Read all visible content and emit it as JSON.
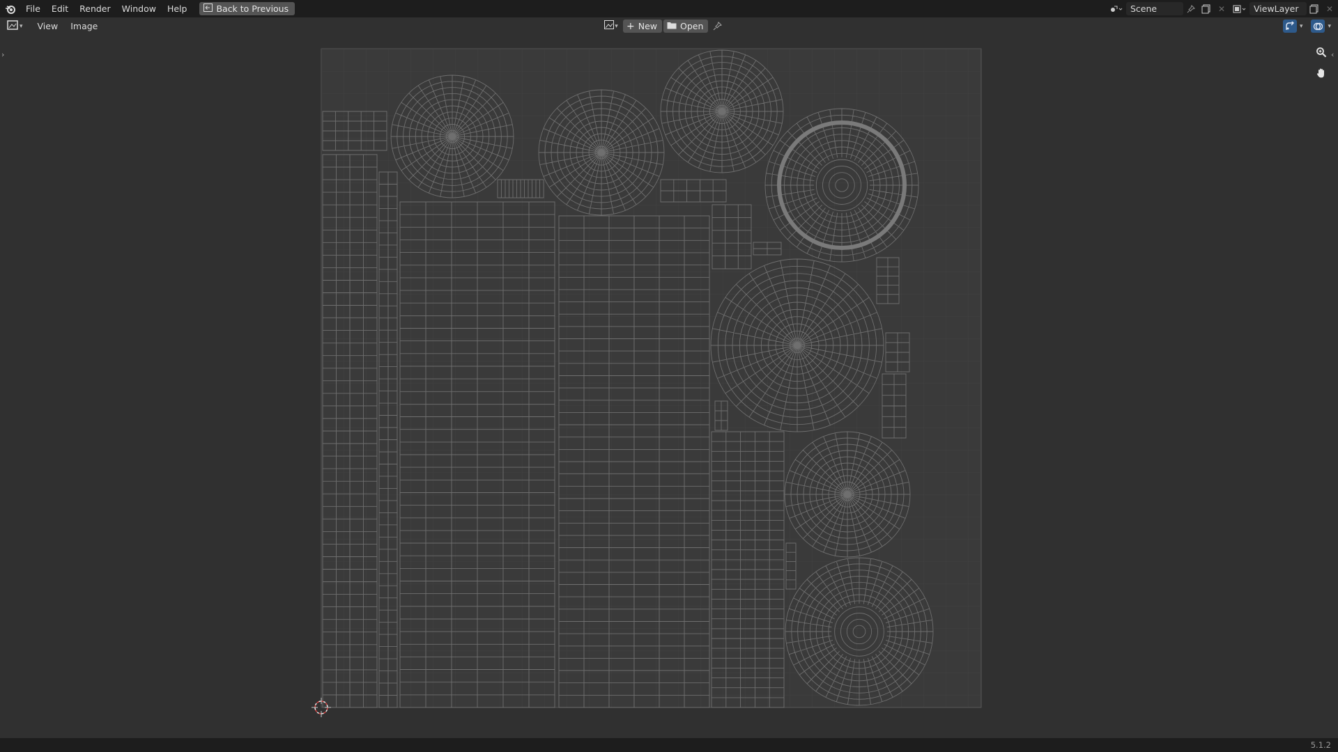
{
  "topbar": {
    "menus": [
      "File",
      "Edit",
      "Render",
      "Window",
      "Help"
    ],
    "back_button": "Back to Previous",
    "scene_name": "Scene",
    "view_layer_name": "ViewLayer"
  },
  "header": {
    "menus": [
      "View",
      "Image"
    ],
    "new_label": "New",
    "open_label": "Open"
  },
  "statusbar": {
    "version": "5.1.2"
  },
  "colors": {
    "background": "#303030",
    "topbar": "#1d1d1d",
    "button": "#545454",
    "accent_blue": "#2e5a8b",
    "uv_line": "#6e6e6e",
    "canvas": "#3c3c3c"
  },
  "icons": [
    "blender-logo-icon",
    "back-icon",
    "scene-icon",
    "view-layer-icon",
    "image-editor-icon",
    "image-browse-icon",
    "plus-icon",
    "folder-icon",
    "pin-icon",
    "uv-sync-icon",
    "overlay-icon",
    "zoom-icon",
    "hand-pan-icon",
    "cursor-2d-icon"
  ]
}
